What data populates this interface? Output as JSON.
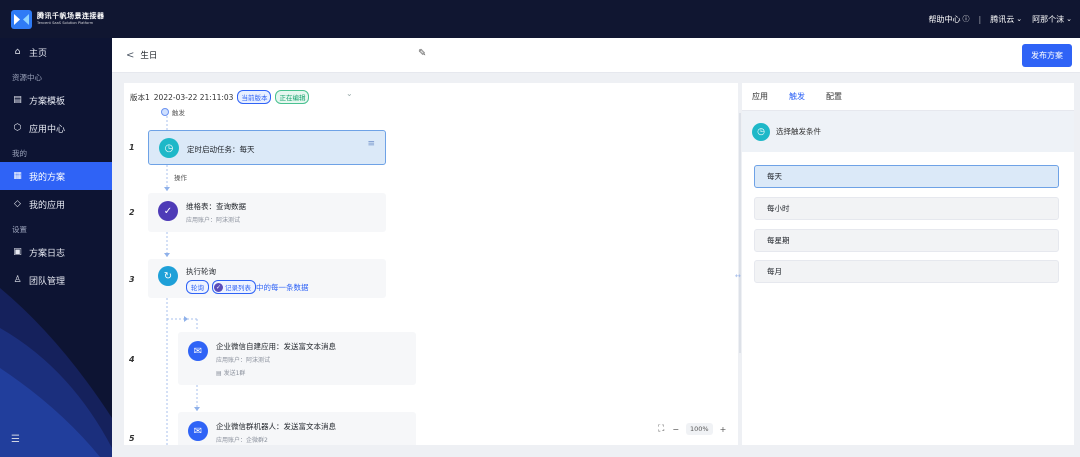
{
  "topbar": {
    "brand_cn": "腾讯千帆场景连接器",
    "brand_en": "Tencent SaaS Solution Platform",
    "help": "帮助中心",
    "help_icon": "question-circle-icon",
    "divider": "|",
    "cloud": "腾讯云",
    "user": "阿那个沫"
  },
  "sidebar": {
    "home": "主页",
    "group_resources": "资源中心",
    "templates": "方案模板",
    "app_center": "应用中心",
    "group_mine": "我的",
    "my_plans": "我的方案",
    "my_apps": "我的应用",
    "group_settings": "设置",
    "plan_logs": "方案日志",
    "team": "团队管理"
  },
  "subheader": {
    "plan_name": "生日",
    "publish": "发布方案"
  },
  "canvas": {
    "version_label": "版本1",
    "version_time": "2022-03-22 21:11:03",
    "tag_current": "当前版本",
    "tag_editing": "正在编辑",
    "trigger_label": "触发",
    "op_label": "操作",
    "steps": [
      {
        "no": "1",
        "title": "定时启动任务：每天",
        "icon": "clock-icon"
      },
      {
        "no": "2",
        "title": "维格表：查询数据",
        "sub": "应用账户：阿沫测试",
        "icon": "vika-icon"
      },
      {
        "no": "3",
        "title": "执行轮询",
        "pill": "轮询",
        "pill2": "记录列表",
        "tail": "中的每一条数据",
        "icon": "loop-icon"
      },
      {
        "no": "4",
        "title": "企业微信自建应用：发送富文本消息",
        "sub": "应用账户：阿沫测试",
        "sub2": "发送1群",
        "icon": "wecom-icon"
      },
      {
        "no": "5",
        "title": "企业微信群机器人：发送富文本消息",
        "sub": "应用账户：企微群2",
        "icon": "wecom-bot-icon"
      }
    ],
    "zoom": "100%",
    "zoom_minus": "−",
    "zoom_plus": "+"
  },
  "panel": {
    "tabs": [
      "应用",
      "触发",
      "配置"
    ],
    "active_tab": "触发",
    "cond_title": "选择触发条件",
    "options": [
      "每天",
      "每小时",
      "每星期",
      "每月"
    ],
    "selected_option": "每天"
  },
  "colors": {
    "brand_blue": "#2f63f6",
    "topbar_bg": "#101631",
    "sidebar_bg": "#0d1433",
    "selected_bg": "#dbe9f8"
  }
}
